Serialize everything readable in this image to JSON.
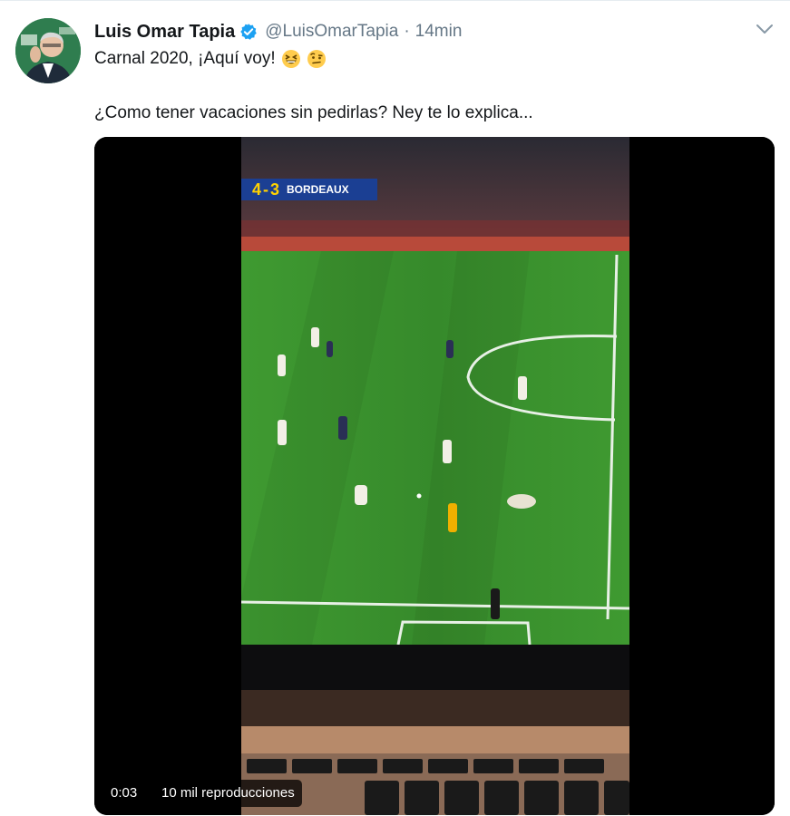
{
  "tweet": {
    "author_name": "Luis Omar Tapia",
    "handle": "@LuisOmarTapia",
    "separator": "·",
    "time": "14min",
    "line1": "Carnal 2020, ¡Aquí voy!",
    "line2": "¿Como tener vacaciones sin pedirlas? Ney te lo explica...",
    "emojis": [
      "grinning-squinting-face",
      "face-with-raised-eyebrow"
    ]
  },
  "video": {
    "elapsed": "0:03",
    "views": "10 mil reproducciones",
    "scoreboard": {
      "score": "4-3",
      "team": "BORDEAUX"
    }
  },
  "colors": {
    "text": "#14171a",
    "secondary": "#657786",
    "verified": "#1da1f2",
    "pitch": "#3c8f2e",
    "scoreboard": "#1b3f93"
  }
}
